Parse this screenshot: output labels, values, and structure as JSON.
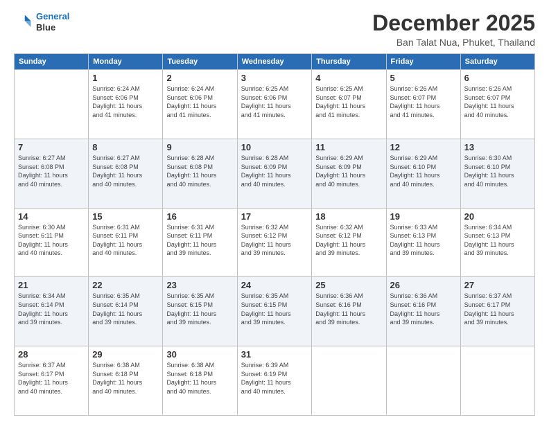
{
  "logo": {
    "line1": "General",
    "line2": "Blue"
  },
  "title": "December 2025",
  "subtitle": "Ban Talat Nua, Phuket, Thailand",
  "columns": [
    "Sunday",
    "Monday",
    "Tuesday",
    "Wednesday",
    "Thursday",
    "Friday",
    "Saturday"
  ],
  "weeks": [
    [
      {
        "day": "",
        "info": ""
      },
      {
        "day": "1",
        "info": "Sunrise: 6:24 AM\nSunset: 6:06 PM\nDaylight: 11 hours\nand 41 minutes."
      },
      {
        "day": "2",
        "info": "Sunrise: 6:24 AM\nSunset: 6:06 PM\nDaylight: 11 hours\nand 41 minutes."
      },
      {
        "day": "3",
        "info": "Sunrise: 6:25 AM\nSunset: 6:06 PM\nDaylight: 11 hours\nand 41 minutes."
      },
      {
        "day": "4",
        "info": "Sunrise: 6:25 AM\nSunset: 6:07 PM\nDaylight: 11 hours\nand 41 minutes."
      },
      {
        "day": "5",
        "info": "Sunrise: 6:26 AM\nSunset: 6:07 PM\nDaylight: 11 hours\nand 41 minutes."
      },
      {
        "day": "6",
        "info": "Sunrise: 6:26 AM\nSunset: 6:07 PM\nDaylight: 11 hours\nand 40 minutes."
      }
    ],
    [
      {
        "day": "7",
        "info": "Sunrise: 6:27 AM\nSunset: 6:08 PM\nDaylight: 11 hours\nand 40 minutes."
      },
      {
        "day": "8",
        "info": "Sunrise: 6:27 AM\nSunset: 6:08 PM\nDaylight: 11 hours\nand 40 minutes."
      },
      {
        "day": "9",
        "info": "Sunrise: 6:28 AM\nSunset: 6:08 PM\nDaylight: 11 hours\nand 40 minutes."
      },
      {
        "day": "10",
        "info": "Sunrise: 6:28 AM\nSunset: 6:09 PM\nDaylight: 11 hours\nand 40 minutes."
      },
      {
        "day": "11",
        "info": "Sunrise: 6:29 AM\nSunset: 6:09 PM\nDaylight: 11 hours\nand 40 minutes."
      },
      {
        "day": "12",
        "info": "Sunrise: 6:29 AM\nSunset: 6:10 PM\nDaylight: 11 hours\nand 40 minutes."
      },
      {
        "day": "13",
        "info": "Sunrise: 6:30 AM\nSunset: 6:10 PM\nDaylight: 11 hours\nand 40 minutes."
      }
    ],
    [
      {
        "day": "14",
        "info": "Sunrise: 6:30 AM\nSunset: 6:11 PM\nDaylight: 11 hours\nand 40 minutes."
      },
      {
        "day": "15",
        "info": "Sunrise: 6:31 AM\nSunset: 6:11 PM\nDaylight: 11 hours\nand 40 minutes."
      },
      {
        "day": "16",
        "info": "Sunrise: 6:31 AM\nSunset: 6:11 PM\nDaylight: 11 hours\nand 39 minutes."
      },
      {
        "day": "17",
        "info": "Sunrise: 6:32 AM\nSunset: 6:12 PM\nDaylight: 11 hours\nand 39 minutes."
      },
      {
        "day": "18",
        "info": "Sunrise: 6:32 AM\nSunset: 6:12 PM\nDaylight: 11 hours\nand 39 minutes."
      },
      {
        "day": "19",
        "info": "Sunrise: 6:33 AM\nSunset: 6:13 PM\nDaylight: 11 hours\nand 39 minutes."
      },
      {
        "day": "20",
        "info": "Sunrise: 6:34 AM\nSunset: 6:13 PM\nDaylight: 11 hours\nand 39 minutes."
      }
    ],
    [
      {
        "day": "21",
        "info": "Sunrise: 6:34 AM\nSunset: 6:14 PM\nDaylight: 11 hours\nand 39 minutes."
      },
      {
        "day": "22",
        "info": "Sunrise: 6:35 AM\nSunset: 6:14 PM\nDaylight: 11 hours\nand 39 minutes."
      },
      {
        "day": "23",
        "info": "Sunrise: 6:35 AM\nSunset: 6:15 PM\nDaylight: 11 hours\nand 39 minutes."
      },
      {
        "day": "24",
        "info": "Sunrise: 6:35 AM\nSunset: 6:15 PM\nDaylight: 11 hours\nand 39 minutes."
      },
      {
        "day": "25",
        "info": "Sunrise: 6:36 AM\nSunset: 6:16 PM\nDaylight: 11 hours\nand 39 minutes."
      },
      {
        "day": "26",
        "info": "Sunrise: 6:36 AM\nSunset: 6:16 PM\nDaylight: 11 hours\nand 39 minutes."
      },
      {
        "day": "27",
        "info": "Sunrise: 6:37 AM\nSunset: 6:17 PM\nDaylight: 11 hours\nand 39 minutes."
      }
    ],
    [
      {
        "day": "28",
        "info": "Sunrise: 6:37 AM\nSunset: 6:17 PM\nDaylight: 11 hours\nand 40 minutes."
      },
      {
        "day": "29",
        "info": "Sunrise: 6:38 AM\nSunset: 6:18 PM\nDaylight: 11 hours\nand 40 minutes."
      },
      {
        "day": "30",
        "info": "Sunrise: 6:38 AM\nSunset: 6:18 PM\nDaylight: 11 hours\nand 40 minutes."
      },
      {
        "day": "31",
        "info": "Sunrise: 6:39 AM\nSunset: 6:19 PM\nDaylight: 11 hours\nand 40 minutes."
      },
      {
        "day": "",
        "info": ""
      },
      {
        "day": "",
        "info": ""
      },
      {
        "day": "",
        "info": ""
      }
    ]
  ]
}
